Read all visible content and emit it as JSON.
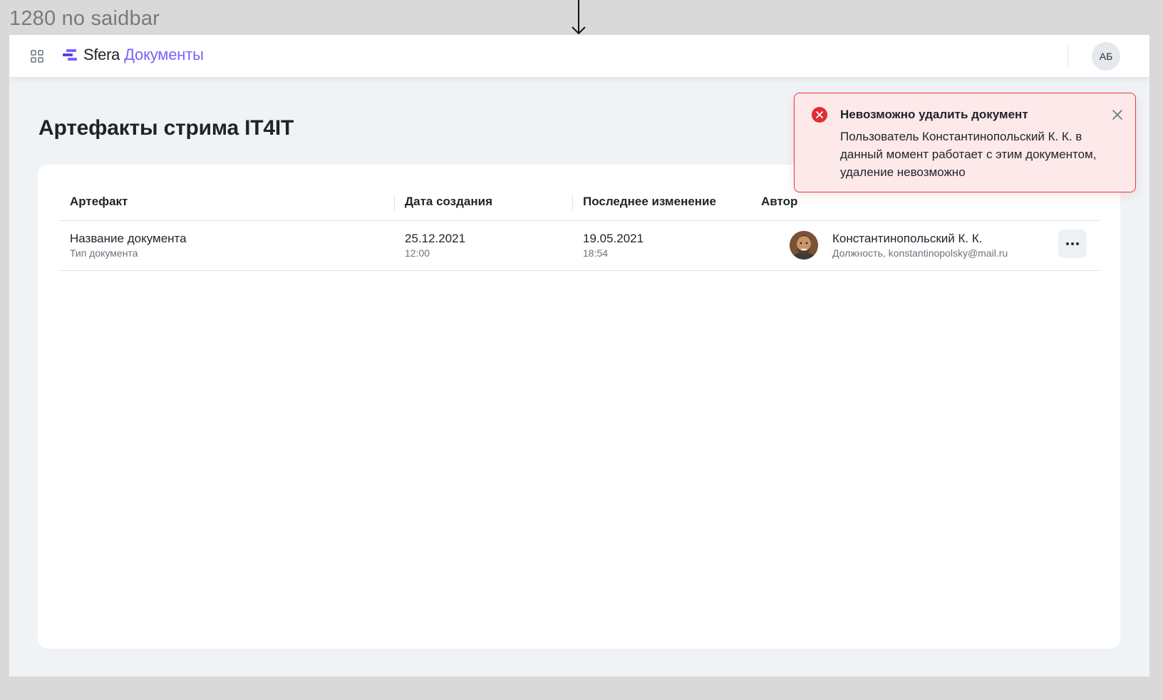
{
  "canvas": {
    "label": "1280 no saidbar"
  },
  "header": {
    "logo_brand": "Sfera",
    "logo_product": "Документы",
    "user_initials": "АБ",
    "icons": {
      "apps": "grid-icon",
      "logo": "sfera-logo-icon"
    }
  },
  "page": {
    "title": "Артефакты стрима IT4IT"
  },
  "table": {
    "columns": [
      "Артефакт",
      "Дата создания",
      "Последнее изменение",
      "Автор"
    ],
    "rows": [
      {
        "artifact_name": "Название документа",
        "artifact_type": "Тип документа",
        "created_date": "25.12.2021",
        "created_time": "12:00",
        "modified_date": "19.05.2021",
        "modified_time": "18:54",
        "author_name": "Константинопольский К. К.",
        "author_details": "Должность, konstantinopolsky@mail.ru"
      }
    ]
  },
  "toast": {
    "title": "Невозможно удалить документ",
    "body": "Пользователь Константинопольский К. К. в данный момент работает с этим документом, удаление невозможно",
    "type": "error",
    "icon": "error-circle-icon"
  },
  "colors": {
    "accent": "#7b61ff",
    "error": "#e8383d",
    "error_bg": "#fde9ea",
    "page_bg": "#f0f3f6"
  }
}
